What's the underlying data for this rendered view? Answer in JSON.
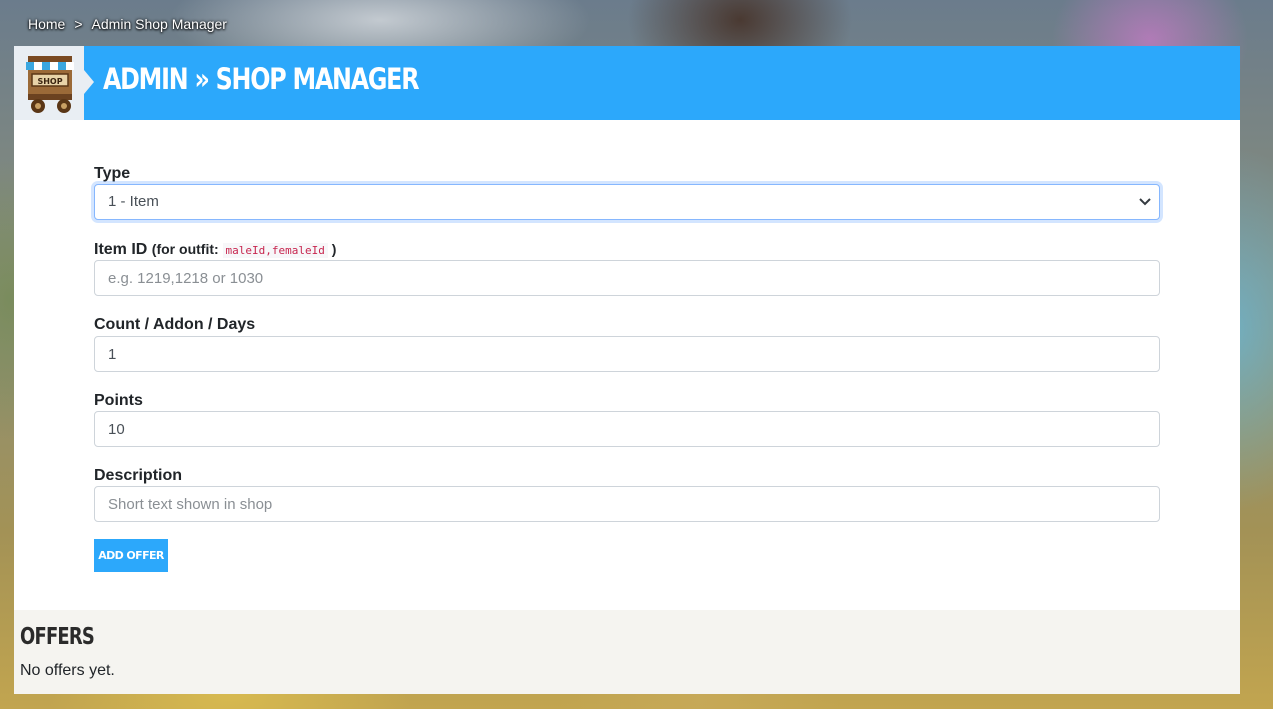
{
  "breadcrumb": {
    "home": "Home",
    "separator": ">",
    "current": "Admin Shop Manager"
  },
  "header": {
    "title": "Admin » Shop Manager",
    "icon": "shop-cart-icon",
    "icon_text": "SHOP"
  },
  "form": {
    "type": {
      "label": "Type",
      "value": "1 - Item"
    },
    "item_id": {
      "label": "Item ID",
      "hint_prefix": "(for outfit:",
      "hint_code": "maleId,femaleId",
      "hint_suffix": ")",
      "placeholder": "e.g. 1219,1218 or 1030"
    },
    "count": {
      "label": "Count / Addon / Days",
      "value": "1"
    },
    "points": {
      "label": "Points",
      "value": "10"
    },
    "description": {
      "label": "Description",
      "placeholder": "Short text shown in shop"
    },
    "submit_label": "Add Offer"
  },
  "offers": {
    "title": "Offers",
    "empty_text": "No offers yet."
  },
  "colors": {
    "accent": "#2ca8fb",
    "panel": "#ffffff",
    "offers_bg": "#f5f4f0"
  }
}
